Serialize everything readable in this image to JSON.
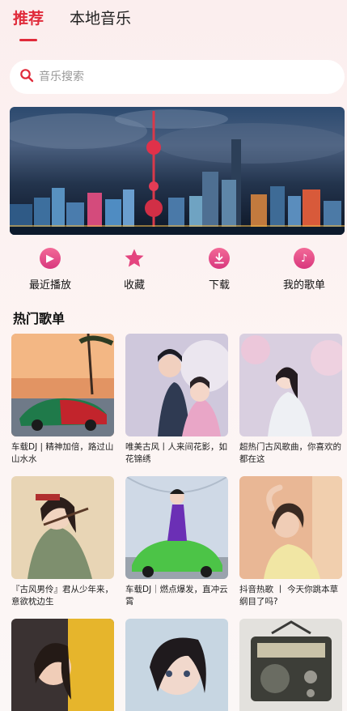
{
  "tabs": [
    {
      "label": "推荐",
      "active": true
    },
    {
      "label": "本地音乐",
      "active": false
    }
  ],
  "search": {
    "placeholder": "音乐搜索"
  },
  "quick_actions": [
    {
      "label": "最近播放",
      "icon": "play-icon"
    },
    {
      "label": "收藏",
      "icon": "star-icon"
    },
    {
      "label": "下载",
      "icon": "download-icon"
    },
    {
      "label": "我的歌单",
      "icon": "music-note-icon"
    }
  ],
  "section": {
    "title": "热门歌单"
  },
  "playlists": [
    {
      "title": "车载DJ | 精神加倍，路过山山水水"
    },
    {
      "title": "唯美古风丨人来间花影，如花锦绣"
    },
    {
      "title": "超热门古风歌曲，你喜欢的都在这"
    },
    {
      "title": "『古风男伶』君从少年来，意欲枕边生"
    },
    {
      "title": "车载DJ｜燃点爆发，直冲云霄"
    },
    {
      "title": "抖音热歌 丨 今天你跳本草纲目了吗?"
    },
    {
      "title": ""
    },
    {
      "title": ""
    },
    {
      "title": ""
    }
  ],
  "colors": {
    "accent": "#e02a3a",
    "icon_pink": "#e4447f"
  }
}
